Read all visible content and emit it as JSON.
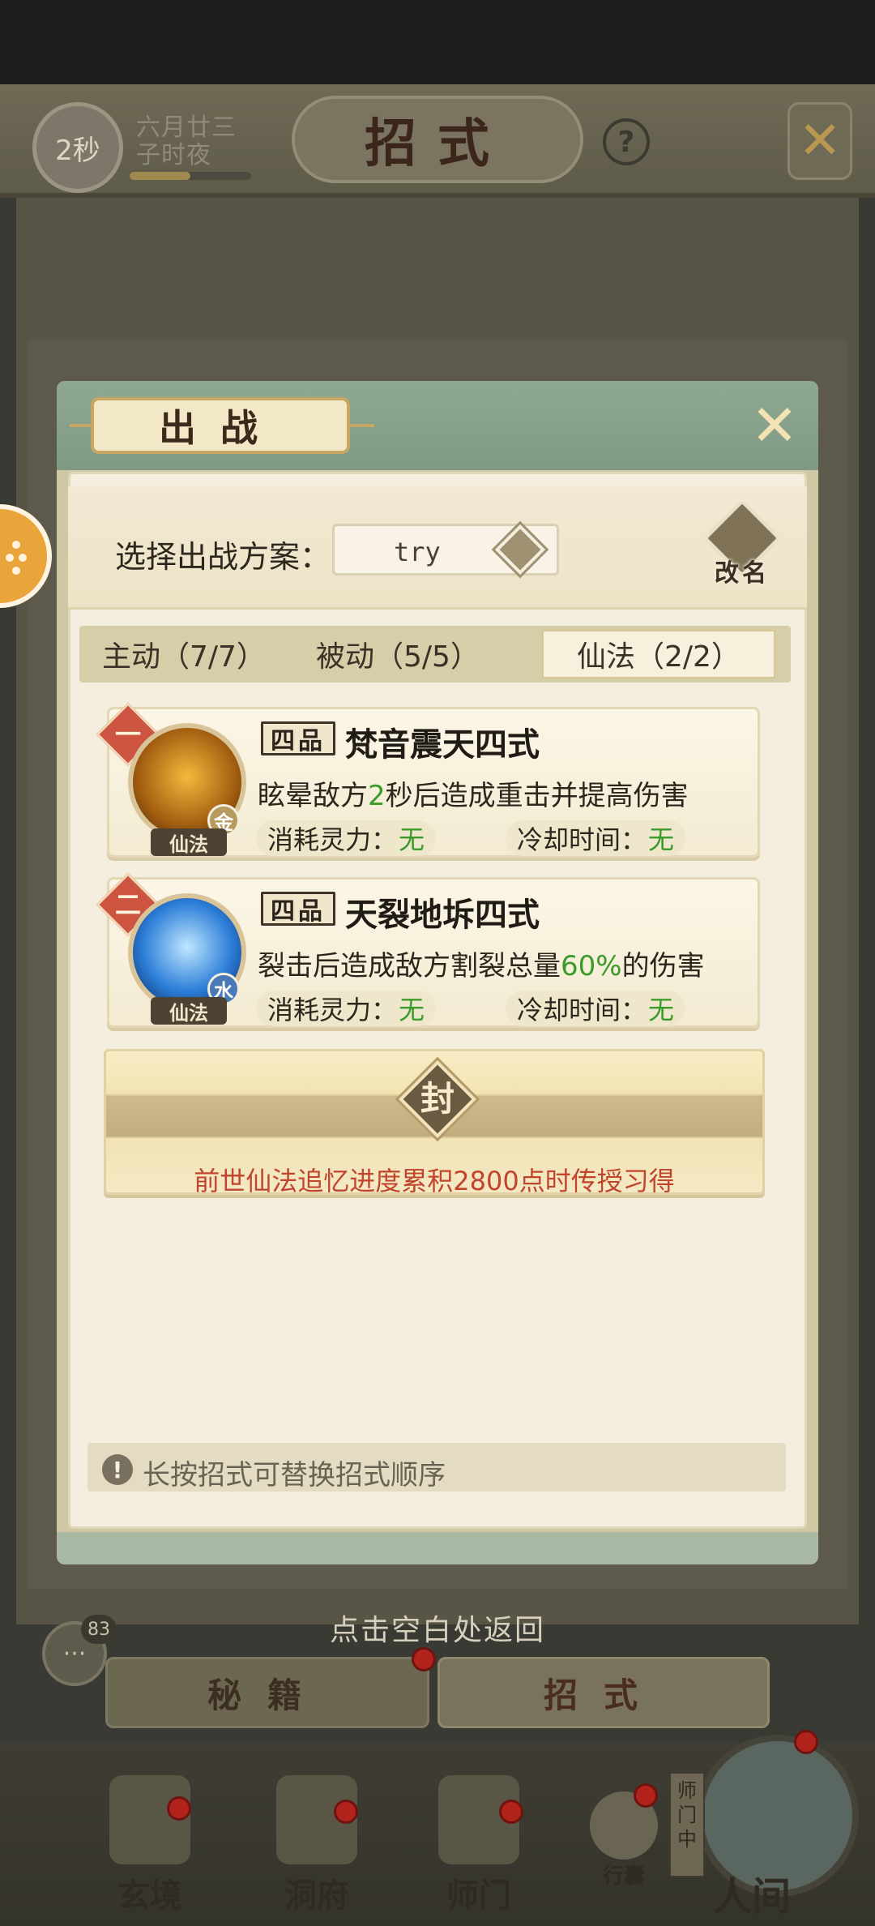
{
  "header": {
    "timer": "2秒",
    "date_line1": "六月廿三",
    "date_line2": "子时夜",
    "date_progress": 0.5,
    "title": "招式",
    "help_label": "?"
  },
  "dialog": {
    "title": "出战",
    "plan_label": "选择出战方案：",
    "plan_value": "try",
    "rename_label": "改名",
    "tabs": [
      {
        "label": "主动（7/7）"
      },
      {
        "label": "被动（5/5）"
      },
      {
        "label": "仙法（2/2）"
      }
    ],
    "skills": [
      {
        "slot": "一",
        "grade": "四品",
        "name": "梵音震天四式",
        "desc_before": "眩晕敌方",
        "desc_highlight": "2",
        "desc_after": "秒后造成重击并提高伤害",
        "type_tag": "仙法",
        "element": "金",
        "cost_label": "消耗灵力：",
        "cost_value": "无",
        "cooldown_label": "冷却时间：",
        "cooldown_value": "无"
      },
      {
        "slot": "二",
        "grade": "四品",
        "name": "天裂地坼四式",
        "desc_before": "裂击后造成敌方割裂总量",
        "desc_highlight": "60%",
        "desc_after": "的伤害",
        "type_tag": "仙法",
        "element": "水",
        "cost_label": "消耗灵力：",
        "cost_value": "无",
        "cooldown_label": "冷却时间：",
        "cooldown_value": "无"
      }
    ],
    "sealed": {
      "seal_char": "封",
      "requirement": "前世仙法追忆进度累积2800点时传授习得"
    },
    "tip": "长按招式可替换招式顺序",
    "tip_icon": "!"
  },
  "back_hint": "点击空白处返回",
  "chat_badge": "83",
  "bottom_tabs": [
    {
      "label": "秘籍"
    },
    {
      "label": "招式"
    }
  ],
  "nav": {
    "items": [
      {
        "label": "玄境"
      },
      {
        "label": "洞府"
      },
      {
        "label": "师门"
      },
      {
        "label": "行囊"
      },
      {
        "label": "人间"
      }
    ],
    "sect_tag": "师门中"
  },
  "colors": {
    "dialog_header": "#8fa892",
    "accent_red": "#cc5440",
    "highlight_green": "#3a9b2a",
    "requirement_red": "#c1442d"
  },
  "icons": {
    "close": "close-x-icon",
    "help": "question-icon",
    "rename": "brush-icon",
    "dropdown": "chevron-down-icon",
    "tip": "exclamation-icon",
    "chat": "chat-bubble-icon"
  }
}
